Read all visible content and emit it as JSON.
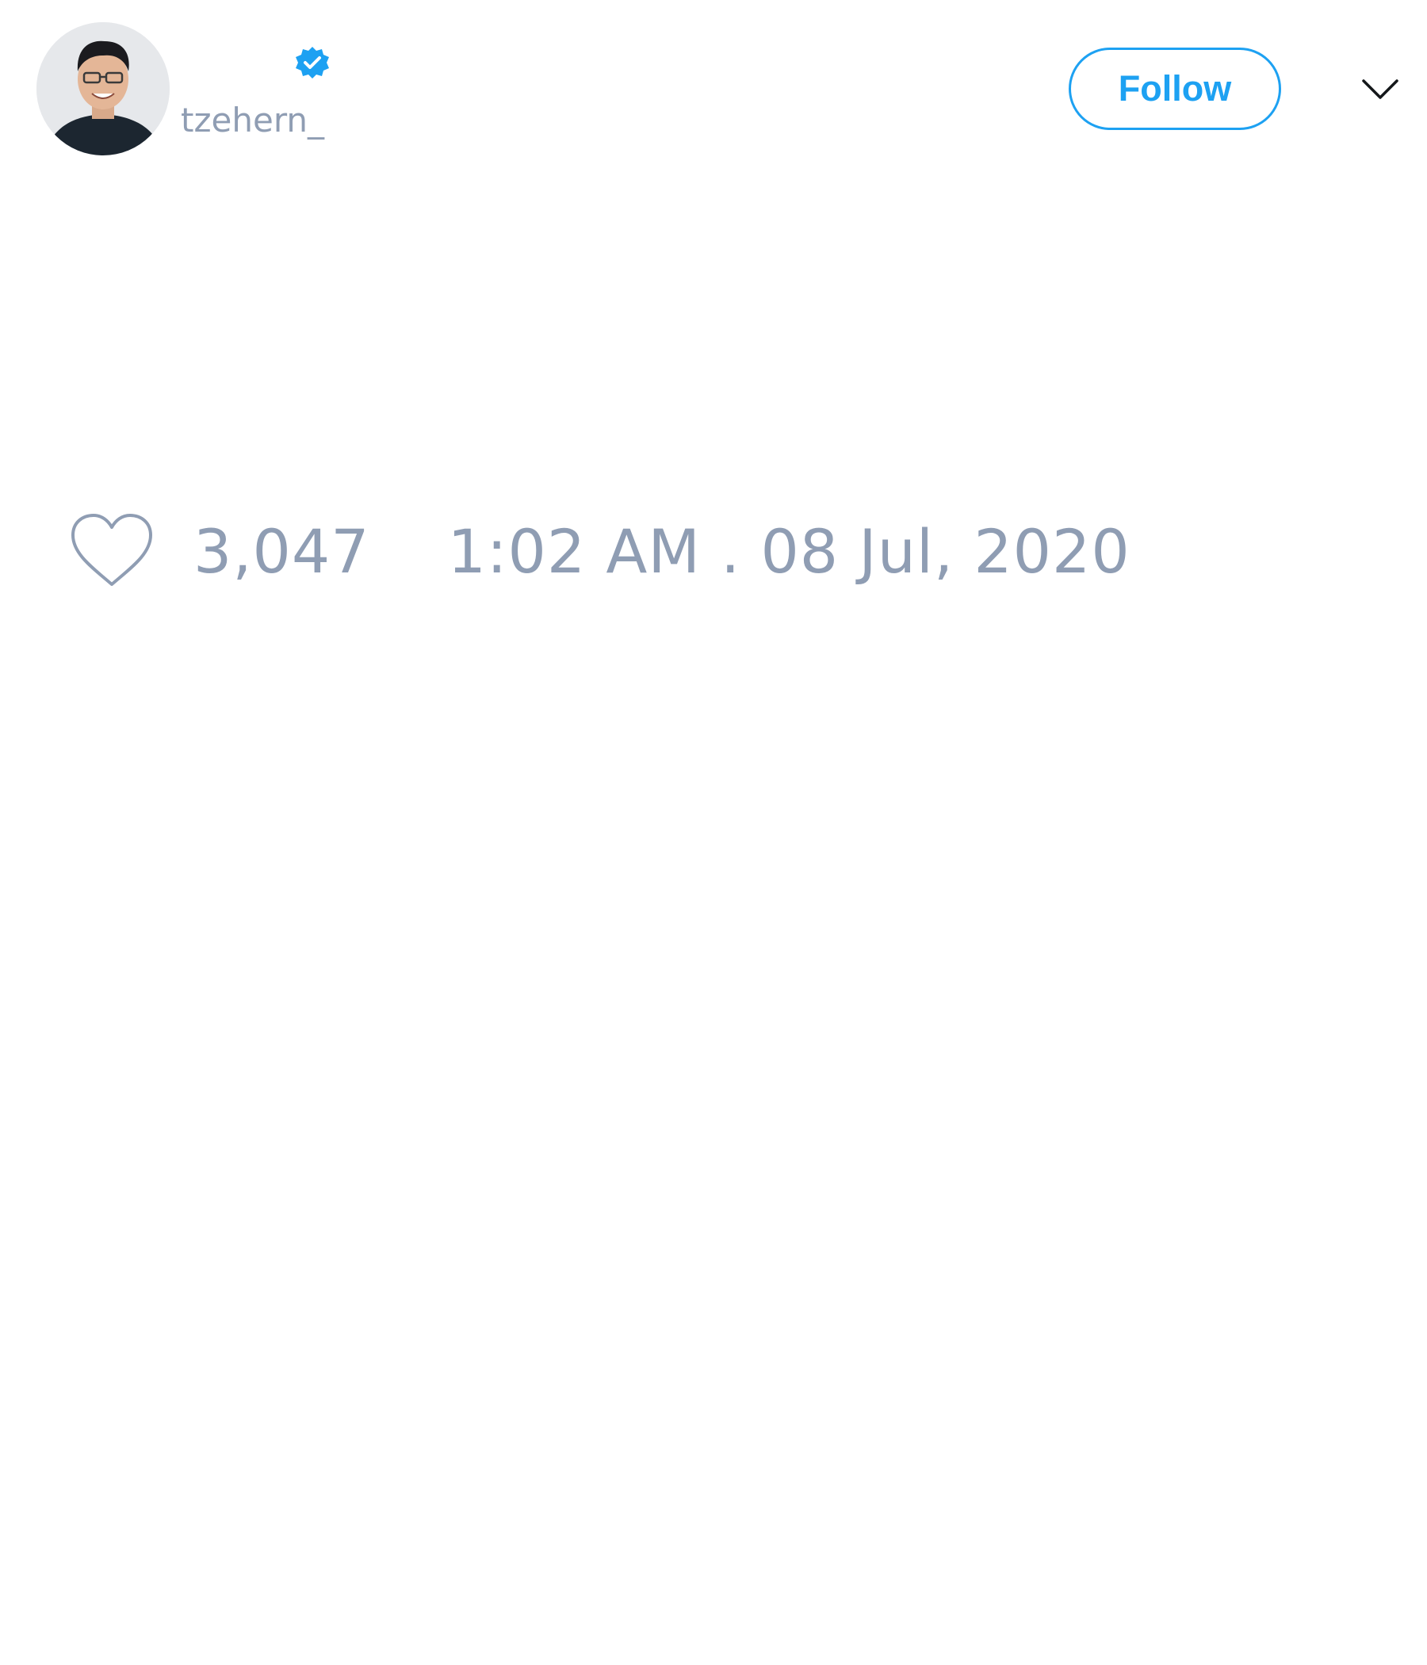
{
  "tweet": {
    "author": {
      "display_name": "",
      "username": "tzehern_",
      "verified": true,
      "verified_icon": "verified-badge-icon",
      "avatar_icon": "avatar-photo"
    },
    "follow_label": "Follow",
    "menu_icon": "chevron-down-icon",
    "body_text": "",
    "like_icon": "heart-icon",
    "like_count": "3,047",
    "timestamp": "1:02 AM . 08 Jul, 2020"
  },
  "colors": {
    "accent": "#1da1f2",
    "muted_text": "#8f9db3",
    "background": "#ffffff"
  }
}
